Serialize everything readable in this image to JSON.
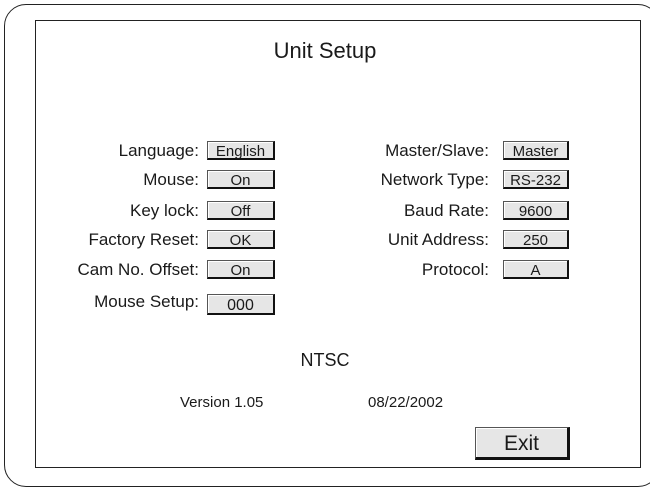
{
  "title": "Unit Setup",
  "left_settings": [
    {
      "label": "Language:",
      "value": "English"
    },
    {
      "label": "Mouse:",
      "value": "On"
    },
    {
      "label": "Key lock:",
      "value": "Off"
    },
    {
      "label": "Factory Reset:",
      "value": "OK"
    },
    {
      "label": "Cam No. Offset:",
      "value": "On"
    },
    {
      "label": "Mouse Setup:",
      "value": "000"
    }
  ],
  "right_settings": [
    {
      "label": "Master/Slave:",
      "value": "Master"
    },
    {
      "label": "Network Type:",
      "value": "RS-232"
    },
    {
      "label": "Baud Rate:",
      "value": "9600"
    },
    {
      "label": "Unit Address:",
      "value": "250"
    },
    {
      "label": "Protocol:",
      "value": "A"
    }
  ],
  "video_standard": "NTSC",
  "version": "Version 1.05",
  "date": "08/22/2002",
  "exit_label": "Exit"
}
